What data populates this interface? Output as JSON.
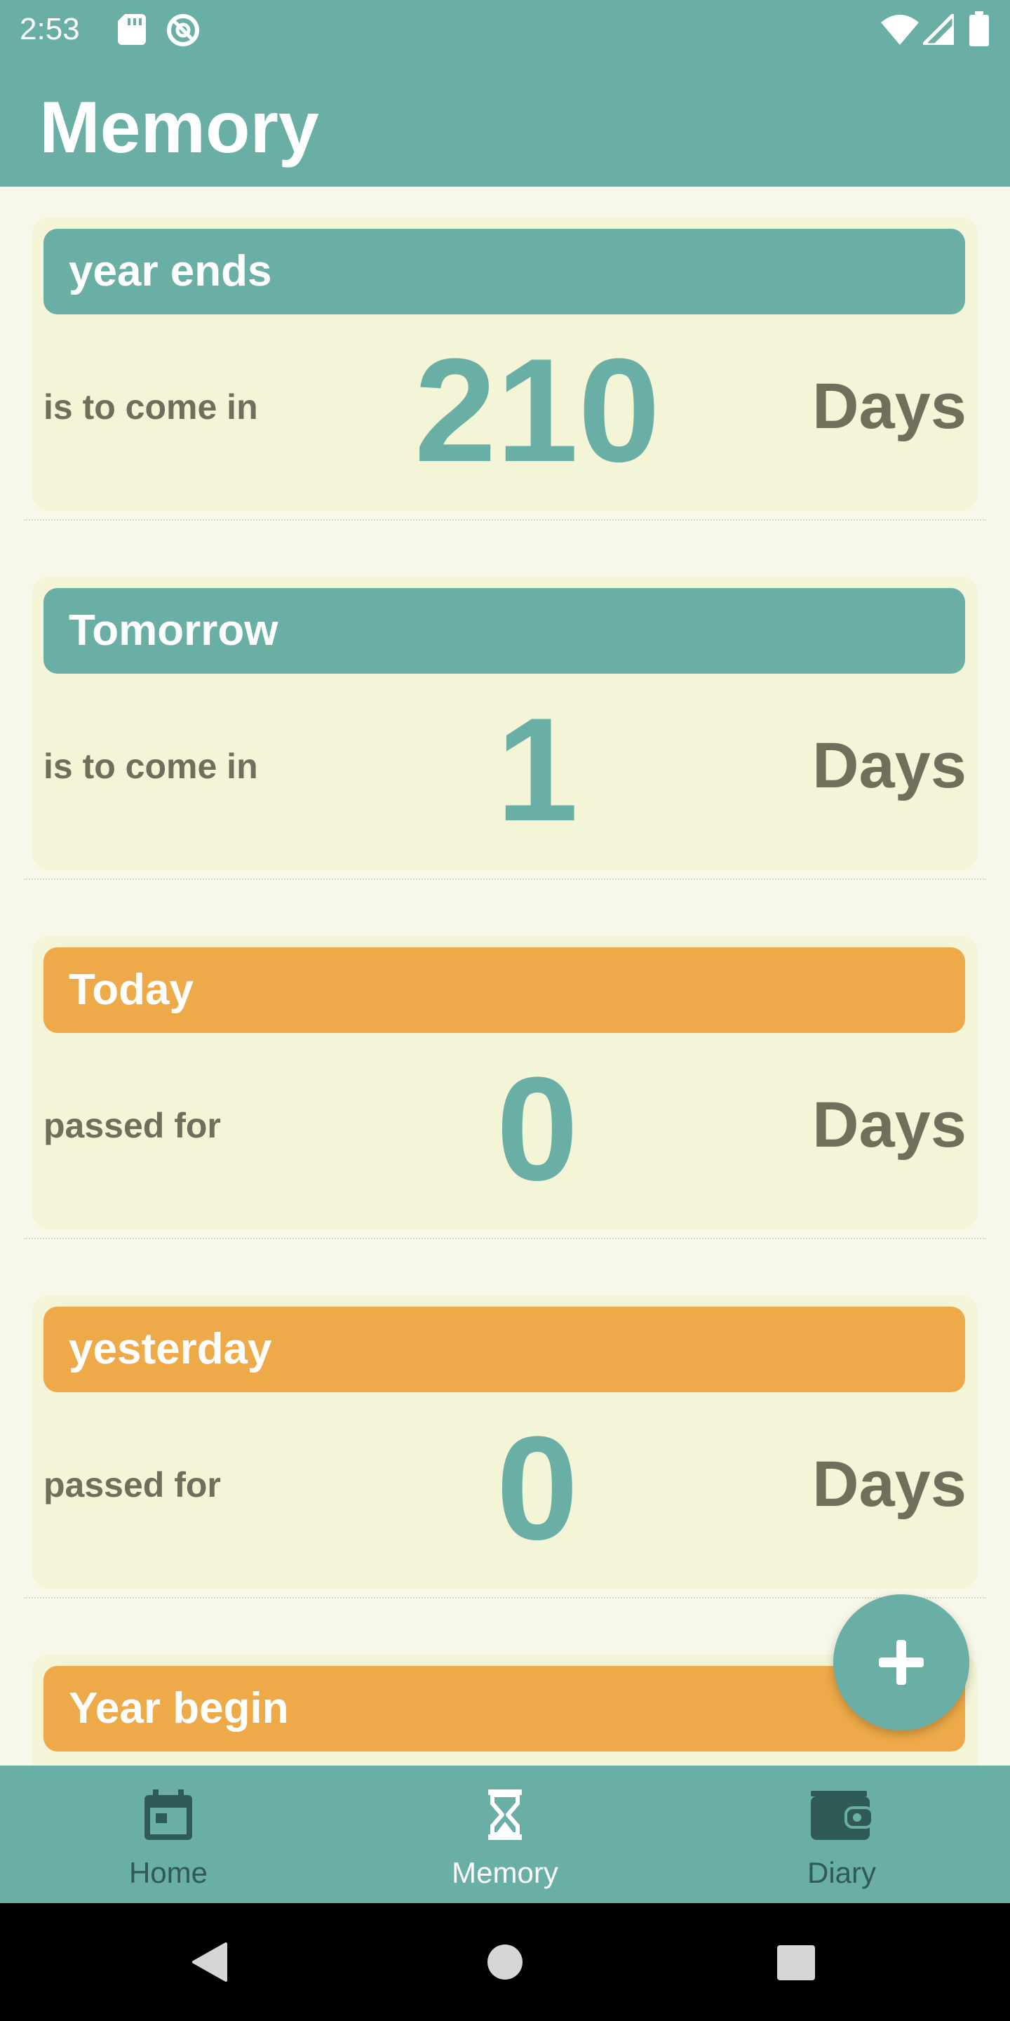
{
  "status_bar": {
    "time": "2:53",
    "icons": [
      "sd-card-icon",
      "do-not-disturb-icon",
      "wifi-icon",
      "signal-icon",
      "battery-icon"
    ]
  },
  "app_bar": {
    "title": "Memory"
  },
  "colors": {
    "primary": "#6aafa6",
    "accent_orange": "#eeaa48",
    "card_bg": "#f4f4d6",
    "page_bg": "#f8f8ea",
    "caption_text": "#6f6f5c",
    "nav_inactive": "#2f5a56"
  },
  "cards": [
    {
      "title": "year ends",
      "caption": "is to come in",
      "count": "210",
      "unit": "Days",
      "header_color": "teal"
    },
    {
      "title": "Tomorrow",
      "caption": "is to come in",
      "count": "1",
      "unit": "Days",
      "header_color": "teal"
    },
    {
      "title": "Today",
      "caption": "passed for",
      "count": "0",
      "unit": "Days",
      "header_color": "orange"
    },
    {
      "title": "yesterday",
      "caption": "passed for",
      "count": "0",
      "unit": "Days",
      "header_color": "orange"
    },
    {
      "title": "Year begin",
      "header_color": "orange"
    }
  ],
  "fab": {
    "icon": "plus-icon"
  },
  "bottom_nav": {
    "items": [
      {
        "label": "Home",
        "icon": "calendar-icon",
        "active": false
      },
      {
        "label": "Memory",
        "icon": "hourglass-icon",
        "active": true
      },
      {
        "label": "Diary",
        "icon": "wallet-icon",
        "active": false
      }
    ]
  },
  "system_nav": {
    "buttons": [
      "back-icon",
      "home-icon",
      "recents-icon"
    ]
  }
}
